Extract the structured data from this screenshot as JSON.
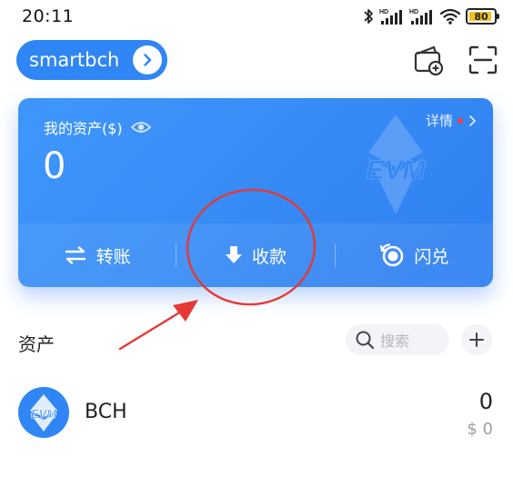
{
  "status_bar": {
    "time": "20:11",
    "battery": "80",
    "icons": [
      "bluetooth-icon",
      "signal-hd-icon",
      "signal-hd-icon",
      "wifi-icon",
      "battery-icon"
    ]
  },
  "header": {
    "network": "smartbch",
    "network_icon": "chevron-right-icon",
    "actions": [
      "wallet-add-icon",
      "scan-icon"
    ]
  },
  "asset_card": {
    "title": "我的资产($)",
    "detail": "详情",
    "balance": "0",
    "watermark": "EVM",
    "actions": [
      {
        "label": "转账",
        "icon": "transfer-icon"
      },
      {
        "label": "收款",
        "icon": "receive-icon"
      },
      {
        "label": "闪兑",
        "icon": "swap-icon"
      }
    ]
  },
  "assets": {
    "title": "资产",
    "search_placeholder": "搜索",
    "tokens": [
      {
        "logo_text": "EVM",
        "name": "BCH",
        "amount": "0",
        "value": "$ 0"
      }
    ]
  },
  "colors": {
    "primary": "#2f86f4",
    "annotation": "#e53935",
    "battery": "#f3c21a"
  }
}
